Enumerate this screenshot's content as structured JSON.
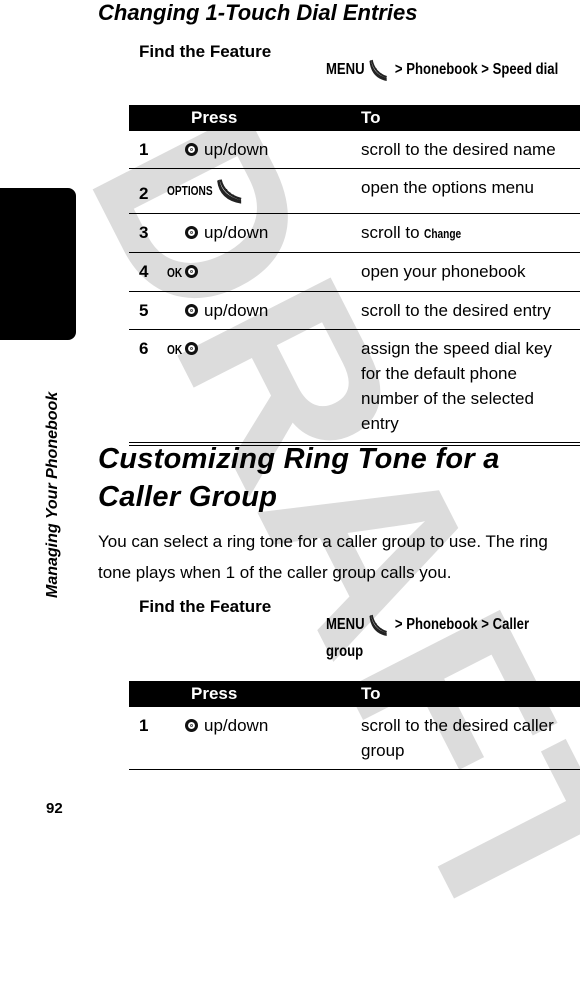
{
  "watermark": "DRAFT",
  "sidebar": {
    "section_label": "Managing Your Phonebook"
  },
  "page_number": "92",
  "section1": {
    "title": "Changing 1-Touch Dial Entries",
    "find_feature": {
      "label": "Find the Feature",
      "path": {
        "menu": "MENU",
        "sep1": ">",
        "item1": "Phonebook",
        "sep2": ">",
        "item2": "Speed dial"
      }
    },
    "table": {
      "headers": {
        "press": "Press",
        "to": "To"
      },
      "rows": [
        {
          "num": "1",
          "key": "",
          "icon": "nav-key",
          "press": "up/down",
          "to": "scroll to the desired name",
          "to_bold": ""
        },
        {
          "num": "2",
          "key": "OPTIONS",
          "icon": "softkey",
          "press": "",
          "to": "open the options menu",
          "to_bold": ""
        },
        {
          "num": "3",
          "key": "",
          "icon": "nav-key",
          "press": "up/down",
          "to": "scroll to ",
          "to_bold": "Change"
        },
        {
          "num": "4",
          "key": "OK",
          "icon": "nav-key",
          "press": "",
          "to": "open your phonebook",
          "to_bold": ""
        },
        {
          "num": "5",
          "key": "",
          "icon": "nav-key",
          "press": "up/down",
          "to": "scroll to the desired entry",
          "to_bold": ""
        },
        {
          "num": "6",
          "key": "OK",
          "icon": "nav-key",
          "press": "",
          "to": "assign the speed dial key for the default phone number of the selected entry",
          "to_bold": ""
        }
      ]
    }
  },
  "section2": {
    "title_line1": "Customizing Ring Tone for a",
    "title_line2": "Caller Group",
    "body": "You can select a ring tone for a caller group to use. The ring tone plays when 1 of the caller group calls you.",
    "find_feature": {
      "label": "Find the Feature",
      "path": {
        "menu": "MENU",
        "sep1": ">",
        "item1": "Phonebook",
        "sep2": ">",
        "item2": "Caller group"
      }
    },
    "table": {
      "headers": {
        "press": "Press",
        "to": "To"
      },
      "rows": [
        {
          "num": "1",
          "key": "",
          "icon": "nav-key",
          "press": "up/down",
          "to": "scroll to the desired caller group",
          "to_bold": ""
        }
      ]
    }
  }
}
